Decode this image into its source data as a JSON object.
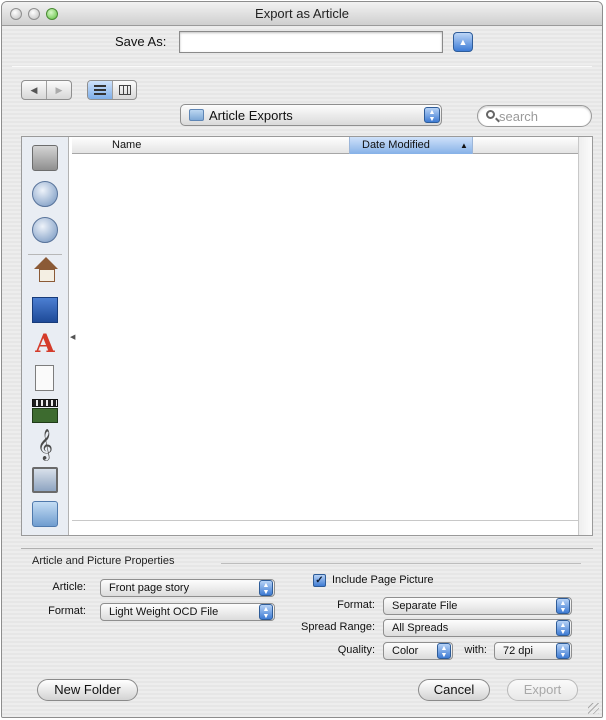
{
  "window": {
    "title": "Export as Article"
  },
  "save": {
    "label": "Save As:",
    "value": ""
  },
  "location": {
    "folder": "Article Exports"
  },
  "search": {
    "placeholder": "search"
  },
  "sidebar": {
    "icons": [
      "hard-disk-icon",
      "network-globe-icon",
      "idisk-globe-icon",
      "home-icon",
      "desktop-icon",
      "applications-icon",
      "documents-icon",
      "movies-icon",
      "music-icon",
      "pictures-icon",
      "folder-icon"
    ]
  },
  "file_list": {
    "columns": [
      "Name",
      "Date Modified"
    ],
    "sort_column": "Date Modified",
    "rows": []
  },
  "properties": {
    "title": "Article and Picture Properties",
    "article_label": "Article:",
    "article_value": "Front page story",
    "format_label": "Format:",
    "format_value": "Light Weight OCD File",
    "include_picture_label": "Include Page Picture",
    "include_picture_checked": true,
    "picture_format_label": "Format:",
    "picture_format_value": "Separate File",
    "spread_range_label": "Spread Range:",
    "spread_range_value": "All Spreads",
    "quality_label": "Quality:",
    "quality_value": "Color",
    "with_label": "with:",
    "dpi_value": "72 dpi"
  },
  "buttons": {
    "new_folder": "New Folder",
    "cancel": "Cancel",
    "export": "Export"
  },
  "colors": {
    "accent": "#3e7bd3",
    "selected_header": "#86b1e7"
  }
}
